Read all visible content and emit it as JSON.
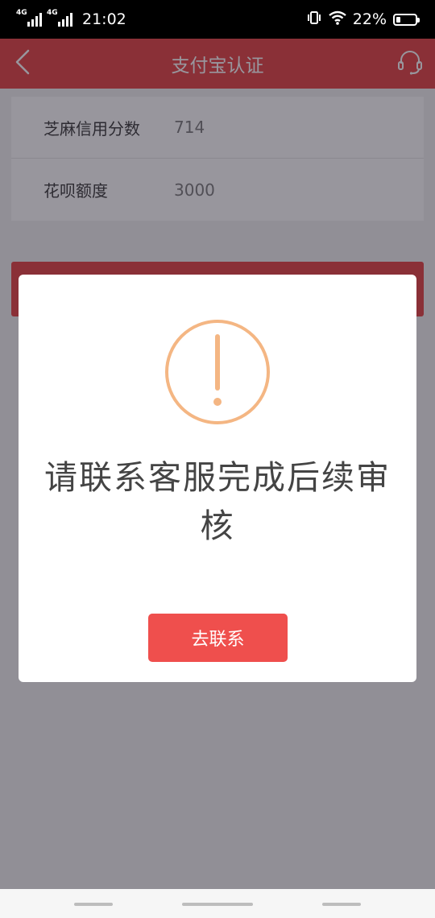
{
  "status_bar": {
    "sim1_network": "4G",
    "sim2_network": "4G",
    "time": "21:02",
    "battery_percent_label": "22%",
    "battery_level": 0.22
  },
  "header": {
    "title": "支付宝认证"
  },
  "info": {
    "rows": [
      {
        "label": "芝麻信用分数",
        "value": "714"
      },
      {
        "label": "花呗额度",
        "value": "3000"
      }
    ]
  },
  "dialog": {
    "message": "请联系客服完成后续审核",
    "button_label": "去联系"
  },
  "icons": {
    "back": "chevron-left-icon",
    "service": "headset-icon",
    "warning": "exclamation-circle-icon"
  },
  "colors": {
    "brand_red": "#e53d3c",
    "button_red": "#ef4f4d",
    "warning_orange": "#f4b683"
  }
}
